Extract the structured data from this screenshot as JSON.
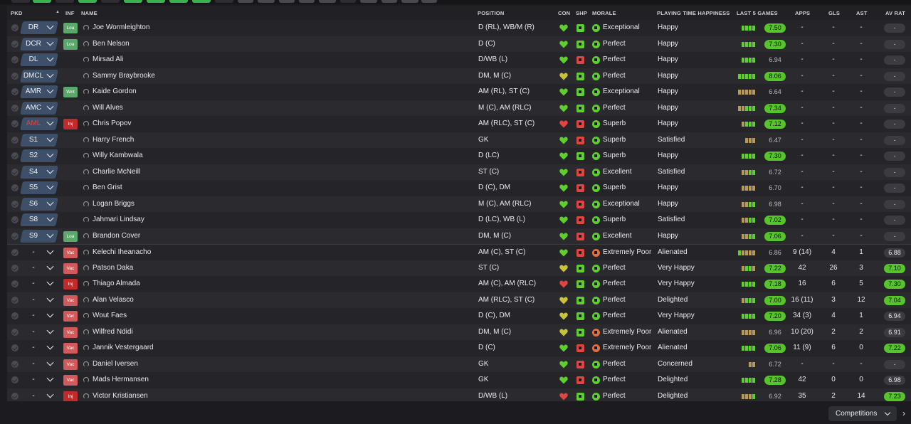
{
  "top_strip": [
    {
      "color": "#2d2d33"
    },
    {
      "color": "#38b24a"
    },
    {
      "color": "#2d2d33"
    },
    {
      "color": "#38b24a"
    },
    {
      "color": "#2d2d33"
    },
    {
      "color": "#38b24a"
    },
    {
      "color": "#38b24a"
    },
    {
      "color": "#38b24a"
    },
    {
      "color": "#38b24a"
    },
    {
      "color": "#2d2d33"
    },
    {
      "color": "#484851"
    },
    {
      "color": "#484851"
    },
    {
      "color": "#484851"
    },
    {
      "color": "#484851"
    },
    {
      "color": "#484851"
    },
    {
      "color": "#2d2d33"
    },
    {
      "color": "#484851"
    },
    {
      "color": "#484851"
    },
    {
      "color": "#484851"
    },
    {
      "color": "#484851"
    }
  ],
  "headers": {
    "pkd": "PKD",
    "inf": "INF",
    "name": "NAME",
    "position": "POSITION",
    "con": "CON",
    "shp": "SHP",
    "morale": "MORALE",
    "happiness": "PLAYING TIME HAPPINESS",
    "last5": "LAST 5 GAMES",
    "apps": "APPS",
    "gls": "GLS",
    "ast": "AST",
    "avrat": "AV RAT"
  },
  "colors": {
    "green": "#5fcf2e",
    "lightgreen": "#7fe04a",
    "yellow": "#c9c33c",
    "tan": "#b79a5a",
    "red": "#e0453f",
    "orange": "#e0703f"
  },
  "players": [
    {
      "pkd": "DR",
      "inf": "Loa",
      "name": "Joe Wormleighton",
      "position": "D (RL), WB/M (R)",
      "con": "green",
      "shp": "green",
      "morale": "Exceptional",
      "happiness": "Happy",
      "last5": [
        "green",
        "green",
        "green",
        "green"
      ],
      "rating": "7.50",
      "rating_style": "g",
      "apps": "-",
      "gls": "-",
      "ast": "-",
      "avrat": "-"
    },
    {
      "pkd": "DCR",
      "inf": "Loa",
      "name": "Ben Nelson",
      "position": "D (C)",
      "con": "green",
      "shp": "green",
      "morale": "Perfect",
      "happiness": "Happy",
      "last5": [
        "green",
        "green",
        "green",
        "green"
      ],
      "rating": "7.30",
      "rating_style": "g",
      "apps": "-",
      "gls": "-",
      "ast": "-",
      "avrat": "-"
    },
    {
      "pkd": "DL",
      "inf": "",
      "name": "Mirsad Ali",
      "position": "D/WB (L)",
      "con": "green",
      "shp": "red",
      "morale": "Perfect",
      "happiness": "Happy",
      "last5": [
        "green",
        "green",
        "green",
        "green"
      ],
      "rating": "6.94",
      "rating_style": "plain",
      "apps": "-",
      "gls": "-",
      "ast": "-",
      "avrat": "-"
    },
    {
      "pkd": "DMCL",
      "inf": "",
      "name": "Sammy Braybrooke",
      "position": "DM, M (C)",
      "con": "yellow",
      "shp": "green",
      "morale": "Perfect",
      "happiness": "Happy",
      "last5": [
        "green",
        "green",
        "green",
        "green",
        "green"
      ],
      "rating": "8.06",
      "rating_style": "g",
      "apps": "-",
      "gls": "-",
      "ast": "-",
      "avrat": "-"
    },
    {
      "pkd": "AMR",
      "inf": "Wnt",
      "name": "Kaide Gordon",
      "position": "AM (RL), ST (C)",
      "con": "green",
      "shp": "green",
      "morale": "Exceptional",
      "happiness": "Happy",
      "last5": [
        "tan",
        "tan",
        "tan",
        "tan",
        "tan"
      ],
      "rating": "6.64",
      "rating_style": "plain",
      "apps": "-",
      "gls": "-",
      "ast": "-",
      "avrat": "-"
    },
    {
      "pkd": "AMC",
      "inf": "",
      "name": "Will Alves",
      "position": "M (C), AM (RLC)",
      "con": "green",
      "shp": "green",
      "morale": "Perfect",
      "happiness": "Happy",
      "last5": [
        "tan",
        "tan",
        "green",
        "green",
        "green"
      ],
      "rating": "7.34",
      "rating_style": "g",
      "apps": "-",
      "gls": "-",
      "ast": "-",
      "avrat": "-"
    },
    {
      "pkd": "AML",
      "pkd_red": true,
      "inf": "Inj",
      "name": "Chris Popov",
      "position": "AM (RLC), ST (C)",
      "con": "red",
      "shp": "red",
      "morale": "Superb",
      "happiness": "Happy",
      "last5": [
        "tan",
        "green",
        "green",
        "green"
      ],
      "rating": "7.12",
      "rating_style": "g",
      "apps": "-",
      "gls": "-",
      "ast": "-",
      "avrat": "-"
    },
    {
      "pkd": "S1",
      "inf": "",
      "name": "Harry French",
      "position": "GK",
      "con": "green",
      "shp": "red",
      "morale": "Superb",
      "happiness": "Satisfied",
      "last5": [
        "tan",
        "tan",
        "tan"
      ],
      "rating": "6.47",
      "rating_style": "plain",
      "apps": "-",
      "gls": "-",
      "ast": "-",
      "avrat": "-"
    },
    {
      "pkd": "S2",
      "inf": "",
      "name": "Willy Kambwala",
      "position": "D (LC)",
      "con": "green",
      "shp": "green",
      "morale": "Superb",
      "happiness": "Happy",
      "last5": [
        "green",
        "green",
        "green",
        "green"
      ],
      "rating": "7.30",
      "rating_style": "g",
      "apps": "-",
      "gls": "-",
      "ast": "-",
      "avrat": "-"
    },
    {
      "pkd": "S4",
      "inf": "",
      "name": "Charlie McNeill",
      "position": "ST (C)",
      "con": "green",
      "shp": "red",
      "morale": "Excellent",
      "happiness": "Satisfied",
      "last5": [
        "tan",
        "tan",
        "green",
        "green"
      ],
      "rating": "6.72",
      "rating_style": "plain",
      "apps": "-",
      "gls": "-",
      "ast": "-",
      "avrat": "-"
    },
    {
      "pkd": "S5",
      "inf": "",
      "name": "Ben Grist",
      "position": "D (C), DM",
      "con": "green",
      "shp": "red",
      "morale": "Superb",
      "happiness": "Happy",
      "last5": [
        "tan",
        "tan",
        "tan",
        "tan"
      ],
      "rating": "6.70",
      "rating_style": "plain",
      "apps": "-",
      "gls": "-",
      "ast": "-",
      "avrat": "-"
    },
    {
      "pkd": "S6",
      "inf": "",
      "name": "Logan Briggs",
      "position": "M (C), AM (RLC)",
      "con": "green",
      "shp": "red",
      "morale": "Exceptional",
      "happiness": "Happy",
      "last5": [
        "tan",
        "tan",
        "green",
        "green"
      ],
      "rating": "6.98",
      "rating_style": "plain",
      "apps": "-",
      "gls": "-",
      "ast": "-",
      "avrat": "-"
    },
    {
      "pkd": "S8",
      "inf": "",
      "name": "Jahmari Lindsay",
      "position": "D (LC), WB (L)",
      "con": "green",
      "shp": "red",
      "morale": "Superb",
      "happiness": "Satisfied",
      "last5": [
        "tan",
        "tan",
        "green",
        "green"
      ],
      "rating": "7.02",
      "rating_style": "g",
      "apps": "-",
      "gls": "-",
      "ast": "-",
      "avrat": "-"
    },
    {
      "pkd": "S9",
      "inf": "Loa",
      "name": "Brandon Cover",
      "position": "DM, M (C)",
      "con": "green",
      "shp": "red",
      "morale": "Excellent",
      "happiness": "Happy",
      "last5": [
        "tan",
        "tan",
        "green",
        "green"
      ],
      "rating": "7.06",
      "rating_style": "g",
      "apps": "-",
      "gls": "-",
      "ast": "-",
      "avrat": "-"
    },
    {
      "pkd": "-",
      "inf": "Vac",
      "name": "Kelechi Iheanacho",
      "position": "AM (C), ST (C)",
      "con": "green",
      "shp": "red",
      "morale": "Extremely Poor",
      "happiness": "Alienated",
      "last5": [
        "green",
        "tan",
        "tan",
        "tan",
        "tan"
      ],
      "rating": "6.86",
      "rating_style": "plain",
      "apps": "9 (14)",
      "gls": "4",
      "ast": "1",
      "avrat": "6.88",
      "avrat_style": "n"
    },
    {
      "pkd": "-",
      "inf": "Vac",
      "name": "Patson Daka",
      "position": "ST (C)",
      "con": "yellow",
      "shp": "green",
      "morale": "Perfect",
      "happiness": "Very Happy",
      "last5": [
        "tan",
        "green",
        "green",
        "tan"
      ],
      "rating": "7.22",
      "rating_style": "g",
      "apps": "42",
      "gls": "26",
      "ast": "3",
      "avrat": "7.10",
      "avrat_style": "g"
    },
    {
      "pkd": "-",
      "inf": "Inj",
      "name": "Thiago Almada",
      "position": "AM (C), AM (RLC)",
      "con": "red",
      "shp": "green",
      "morale": "Perfect",
      "happiness": "Very Happy",
      "last5": [
        "green",
        "green",
        "green",
        "green"
      ],
      "rating": "7.18",
      "rating_style": "g",
      "apps": "16",
      "gls": "6",
      "ast": "5",
      "avrat": "7.30",
      "avrat_style": "g"
    },
    {
      "pkd": "-",
      "inf": "Vac",
      "name": "Alan Velasco",
      "position": "AM (RLC), ST (C)",
      "con": "yellow",
      "shp": "green",
      "morale": "Perfect",
      "happiness": "Delighted",
      "last5": [
        "tan",
        "green",
        "green",
        "green"
      ],
      "rating": "7.00",
      "rating_style": "g",
      "apps": "16 (11)",
      "gls": "3",
      "ast": "12",
      "avrat": "7.04",
      "avrat_style": "g"
    },
    {
      "pkd": "-",
      "inf": "Vac",
      "name": "Wout Faes",
      "position": "D (C), DM",
      "con": "yellow",
      "shp": "green",
      "morale": "Perfect",
      "happiness": "Very Happy",
      "last5": [
        "green",
        "green",
        "green",
        "green"
      ],
      "rating": "7.20",
      "rating_style": "g",
      "apps": "34 (3)",
      "gls": "4",
      "ast": "1",
      "avrat": "6.94",
      "avrat_style": "n"
    },
    {
      "pkd": "-",
      "inf": "Vac",
      "name": "Wilfred Ndidi",
      "position": "DM, M (C)",
      "con": "yellow",
      "shp": "green",
      "morale": "Extremely Poor",
      "happiness": "Alienated",
      "last5": [
        "tan",
        "tan",
        "tan",
        "tan"
      ],
      "rating": "6.96",
      "rating_style": "plain",
      "apps": "10 (20)",
      "gls": "2",
      "ast": "2",
      "avrat": "6.91",
      "avrat_style": "n"
    },
    {
      "pkd": "-",
      "inf": "Vac",
      "name": "Jannik Vestergaard",
      "position": "D (C)",
      "con": "green",
      "shp": "red",
      "morale": "Extremely Poor",
      "happiness": "Alienated",
      "last5": [
        "green",
        "green",
        "green",
        "green"
      ],
      "rating": "7.06",
      "rating_style": "g",
      "apps": "11 (9)",
      "gls": "6",
      "ast": "0",
      "avrat": "7.22",
      "avrat_style": "g"
    },
    {
      "pkd": "-",
      "inf": "Vac",
      "name": "Daniel Iversen",
      "position": "GK",
      "con": "green",
      "shp": "red",
      "morale": "Perfect",
      "happiness": "Concerned",
      "last5": [
        "tan",
        "tan"
      ],
      "rating": "6.72",
      "rating_style": "plain",
      "apps": "-",
      "gls": "-",
      "ast": "-",
      "avrat": "-",
      "avrat_style": "d"
    },
    {
      "pkd": "-",
      "inf": "Vac",
      "name": "Mads Hermansen",
      "position": "GK",
      "con": "green",
      "shp": "red",
      "morale": "Perfect",
      "happiness": "Delighted",
      "last5": [
        "green",
        "green",
        "green",
        "green"
      ],
      "rating": "7.28",
      "rating_style": "g",
      "apps": "42",
      "gls": "0",
      "ast": "0",
      "avrat": "6.98",
      "avrat_style": "n"
    },
    {
      "pkd": "-",
      "inf": "Inj",
      "name": "Victor Kristiansen",
      "position": "D/WB (L)",
      "con": "red",
      "shp": "green",
      "morale": "Perfect",
      "happiness": "Delighted",
      "last5": [
        "tan",
        "tan",
        "tan",
        "green"
      ],
      "rating": "6.92",
      "rating_style": "plain",
      "apps": "35",
      "gls": "2",
      "ast": "14",
      "avrat": "7.23",
      "avrat_style": "g"
    }
  ],
  "footer": {
    "competitions_label": "Competitions"
  }
}
